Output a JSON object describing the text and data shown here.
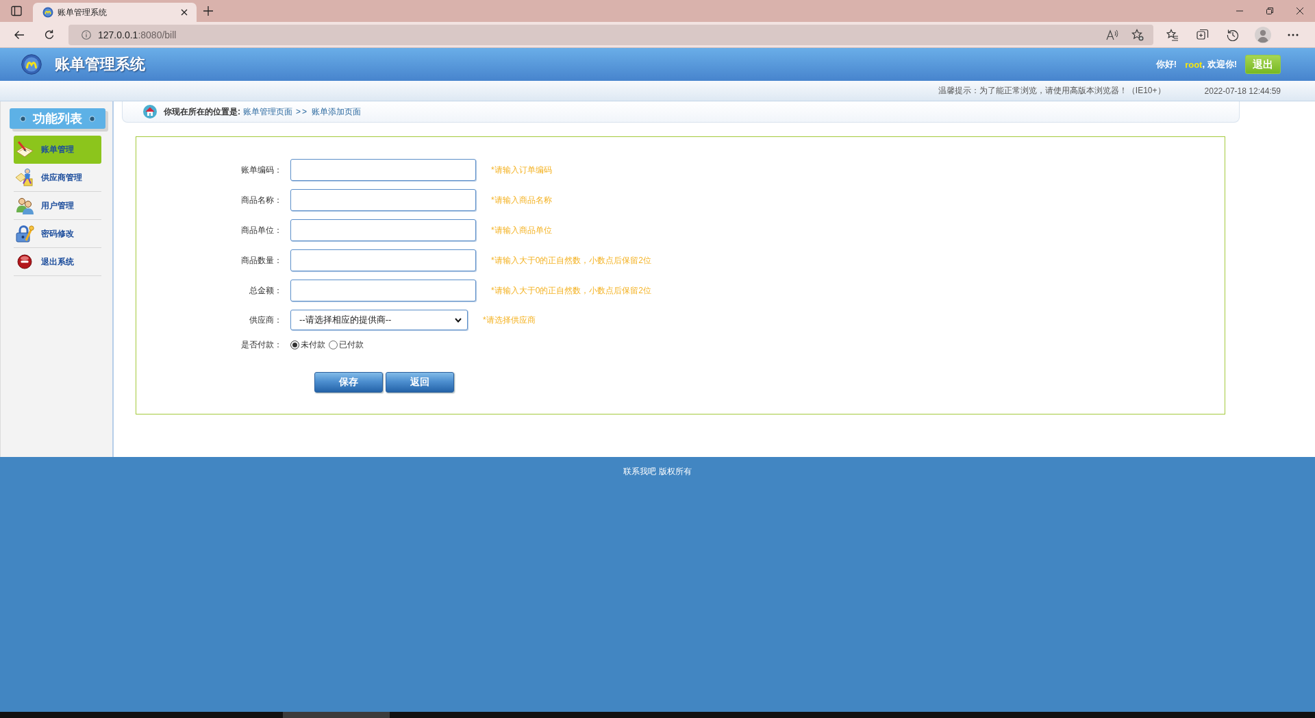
{
  "browser": {
    "tab": {
      "title": "账单管理系统",
      "selected": true
    },
    "url": {
      "host": "127.0.0.1",
      "rest": ":8080/bill"
    }
  },
  "header": {
    "title": "账单管理系统",
    "greeting": "你好!",
    "user": "root",
    "welcome": ", 欢迎你!",
    "logout": "退出"
  },
  "notice": {
    "tip": "温馨提示：为了能正常浏览，请使用高版本浏览器！（IE10+）",
    "datetime": "2022-07-18 12:44:59"
  },
  "sidebar": {
    "title": "功能列表",
    "items": [
      {
        "label": "账单管理",
        "kind": "notebook",
        "selected": true
      },
      {
        "label": "供应商管理",
        "kind": "worker",
        "selected": false
      },
      {
        "label": "用户管理",
        "kind": "users",
        "selected": false
      },
      {
        "label": "密码修改",
        "kind": "lock",
        "selected": false
      },
      {
        "label": "退出系统",
        "kind": "exit",
        "selected": false
      }
    ]
  },
  "breadcrumb": {
    "prefix": "你现在所在的位置是:",
    "link": "账单管理页面",
    "separator": ">>",
    "current": "账单添加页面"
  },
  "form": {
    "fields": [
      {
        "kind": "text",
        "label": "账单编码：",
        "hint": "*请输入订单编码"
      },
      {
        "kind": "text",
        "label": "商品名称：",
        "hint": "*请输入商品名称"
      },
      {
        "kind": "text",
        "label": "商品单位：",
        "hint": "*请输入商品单位"
      },
      {
        "kind": "text",
        "label": "商品数量：",
        "hint": "*请输入大于0的正自然数，小数点后保留2位"
      },
      {
        "kind": "text",
        "label": "总金额：",
        "hint": "*请输入大于0的正自然数，小数点后保留2位"
      },
      {
        "kind": "select",
        "label": "供应商：",
        "value": "--请选择相应的提供商--",
        "hint": "*请选择供应商"
      },
      {
        "kind": "radio",
        "label": "是否付款：",
        "options": [
          {
            "label": "未付款",
            "selected": true
          },
          {
            "label": "已付款",
            "selected": false
          }
        ]
      }
    ],
    "buttons": [
      "保存",
      "返回"
    ]
  },
  "footer": {
    "text": "联系我吧 版权所有"
  }
}
